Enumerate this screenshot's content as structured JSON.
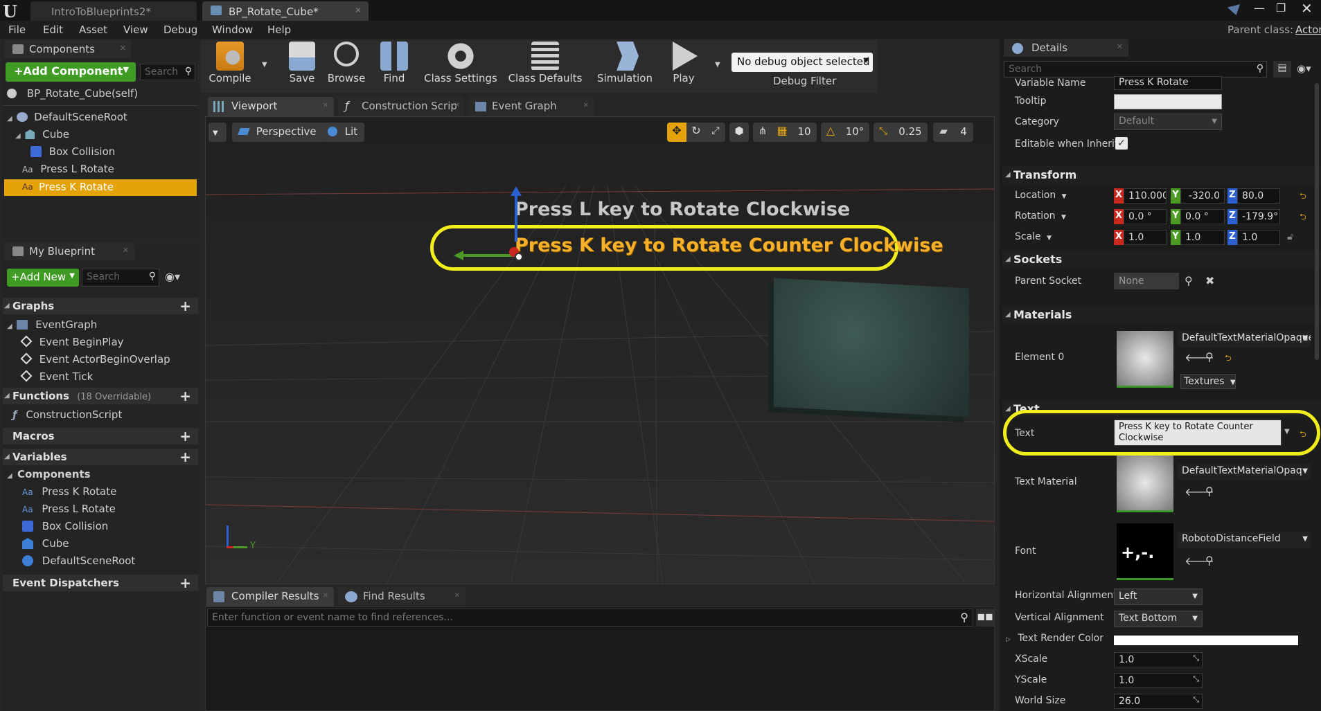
{
  "titlebar": {
    "tabs": [
      {
        "label": "IntroToBlueprints2*"
      },
      {
        "label": "BP_Rotate_Cube*"
      }
    ],
    "parent_class_label": "Parent class:",
    "parent_class_value": "Actor"
  },
  "menu": [
    "File",
    "Edit",
    "Asset",
    "View",
    "Debug",
    "Window",
    "Help"
  ],
  "components_panel": {
    "title": "Components",
    "add_component": "+Add Component",
    "search_placeholder": "Search",
    "self_item": "BP_Rotate_Cube(self)",
    "tree": [
      {
        "label": "DefaultSceneRoot"
      },
      {
        "label": "Cube"
      },
      {
        "label": "Box Collision"
      },
      {
        "label": "Press L Rotate"
      },
      {
        "label": "Press K Rotate"
      }
    ]
  },
  "my_blueprint": {
    "title": "My Blueprint",
    "add_new": "+Add New",
    "search_placeholder": "Search",
    "graphs_header": "Graphs",
    "event_graph": "EventGraph",
    "events": [
      "Event BeginPlay",
      "Event ActorBeginOverlap",
      "Event Tick"
    ],
    "functions_header": "Functions",
    "functions_note": "(18 Overridable)",
    "construction_script": "ConstructionScript",
    "macros_header": "Macros",
    "variables_header": "Variables",
    "components_subheader": "Components",
    "variables": [
      "Press K Rotate",
      "Press L Rotate",
      "Box Collision",
      "Cube",
      "DefaultSceneRoot"
    ],
    "dispatchers_header": "Event Dispatchers"
  },
  "toolbar": {
    "buttons": [
      "Compile",
      "Save",
      "Browse",
      "Find",
      "Class Settings",
      "Class Defaults",
      "Simulation",
      "Play"
    ],
    "debug_object": "No debug object selected",
    "debug_filter": "Debug Filter"
  },
  "editor_tabs": [
    "Viewport",
    "Construction Scrip",
    "Event Graph"
  ],
  "viewport": {
    "perspective": "Perspective",
    "lit": "Lit",
    "grid_snap": "10",
    "rot_snap": "10°",
    "scale_snap": "0.25",
    "camera_speed": "4",
    "text_l": "Press L key to Rotate Clockwise",
    "text_k": "Press K key to Rotate Counter Clockwise",
    "axis_y": "Y"
  },
  "bottom": {
    "tabs": [
      "Compiler Results",
      "Find Results"
    ],
    "find_placeholder": "Enter function or event name to find references..."
  },
  "details": {
    "title": "Details",
    "search_placeholder": "Search",
    "variable_name_label": "Variable Name",
    "variable_name_value": "Press K Rotate",
    "tooltip_label": "Tooltip",
    "tooltip_value": "",
    "category_label": "Category",
    "category_value": "Default",
    "editable_label": "Editable when Inherit",
    "transform_header": "Transform",
    "location_label": "Location",
    "location": [
      "110.000",
      "-320.0",
      "80.0"
    ],
    "rotation_label": "Rotation",
    "rotation": [
      "0.0 °",
      "0.0 °",
      "-179.9°"
    ],
    "scale_label": "Scale",
    "scale": [
      "1.0",
      "1.0",
      "1.0"
    ],
    "sockets_header": "Sockets",
    "parent_socket_label": "Parent Socket",
    "parent_socket_value": "None",
    "materials_header": "Materials",
    "element0_label": "Element 0",
    "element0_material": "DefaultTextMaterialOpaque",
    "textures_label": "Textures",
    "text_header": "Text",
    "text_label": "Text",
    "text_value": "Press K key to Rotate Counter Clockwise",
    "text_material_label": "Text Material",
    "text_material_value": "DefaultTextMaterialOpaq",
    "font_label": "Font",
    "font_value": "RobotoDistanceField",
    "halign_label": "Horizontal Alignment",
    "halign_value": "Left",
    "valign_label": "Vertical Alignment",
    "valign_value": "Text Bottom",
    "render_color_label": "Text Render Color",
    "xscale_label": "XScale",
    "xscale_value": "1.0",
    "yscale_label": "YScale",
    "yscale_value": "1.0",
    "world_size_label": "World Size",
    "world_size_value": "26.0"
  },
  "colors": {
    "accent_green": "#3f9b24",
    "selection": "#e5a30a",
    "highlight_ring": "#f2ee1c",
    "axis_x": "#c8281e",
    "axis_y": "#4a9a24",
    "axis_z": "#2c5fd0"
  }
}
